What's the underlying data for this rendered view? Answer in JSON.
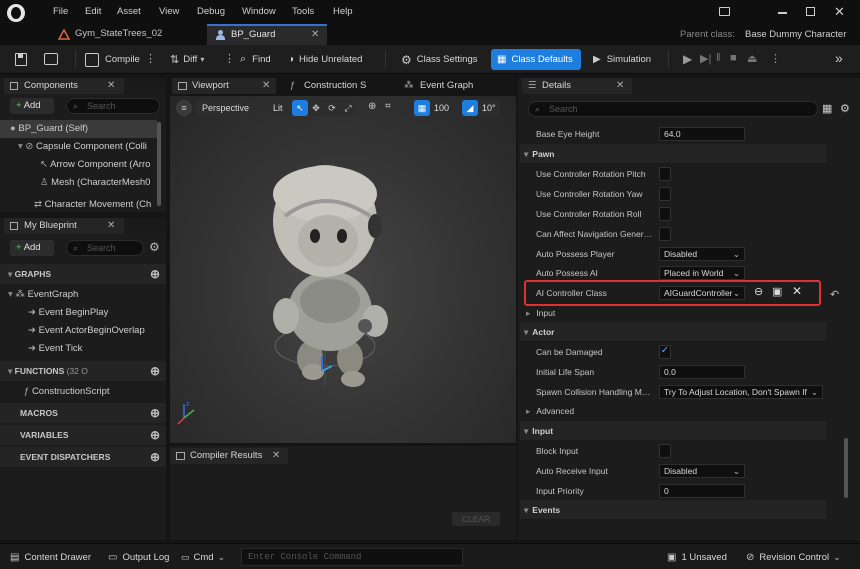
{
  "menu": [
    "File",
    "Edit",
    "Asset",
    "View",
    "Debug",
    "Window",
    "Tools",
    "Help"
  ],
  "tabs": {
    "tab1": "Gym_StateTrees_02",
    "tab2": "BP_Guard"
  },
  "parent_class": {
    "label": "Parent class:",
    "value": "Base Dummy Character"
  },
  "toolbar": {
    "compile": "Compile",
    "diff": "Diff",
    "find": "Find",
    "hide_unrelated": "Hide Unrelated",
    "class_settings": "Class Settings",
    "class_defaults": "Class Defaults",
    "simulation": "Simulation"
  },
  "components": {
    "title": "Components",
    "add": "Add",
    "search_placeholder": "Search",
    "items": [
      {
        "label": "BP_Guard (Self)"
      },
      {
        "label": "Capsule Component (Colli"
      },
      {
        "label": "Arrow Component (Arro"
      },
      {
        "label": "Mesh (CharacterMesh0"
      },
      {
        "label": "Character Movement (Ch"
      }
    ]
  },
  "blueprint": {
    "title": "My Blueprint",
    "add": "Add",
    "search_placeholder": "Search",
    "graphs_label": "GRAPHS",
    "event_graph": "EventGraph",
    "events": [
      "Event BeginPlay",
      "Event ActorBeginOverlap",
      "Event Tick"
    ],
    "functions_label": "FUNCTIONS",
    "functions_count": "(32 O",
    "construction_script": "ConstructionScript",
    "macros": "MACROS",
    "variables": "VARIABLES",
    "event_dispatchers": "EVENT DISPATCHERS"
  },
  "viewport": {
    "tabs": [
      "Viewport",
      "Construction S",
      "Event Graph"
    ],
    "perspective": "Perspective",
    "lit": "Lit",
    "grid_snap": "100",
    "rot_snap": "10°"
  },
  "compiler": {
    "title": "Compiler Results",
    "clear": "CLEAR"
  },
  "details": {
    "title": "Details",
    "search_placeholder": "Search",
    "base_eye_height": {
      "label": "Base Eye Height",
      "value": "64.0"
    },
    "pawn_label": "Pawn",
    "pawn_checks": [
      {
        "label": "Use Controller Rotation Pitch",
        "checked": false
      },
      {
        "label": "Use Controller Rotation Yaw",
        "checked": false
      },
      {
        "label": "Use Controller Rotation Roll",
        "checked": false
      },
      {
        "label": "Can Affect Navigation Gener…",
        "checked": false
      }
    ],
    "auto_possess_player": {
      "label": "Auto Possess Player",
      "value": "Disabled"
    },
    "auto_possess_ai": {
      "label": "Auto Possess AI",
      "value": "Placed in World"
    },
    "ai_controller": {
      "label": "AI Controller Class",
      "value": "AIGuardController"
    },
    "input_label": "Input",
    "actor_label": "Actor",
    "can_be_damaged": {
      "label": "Can be Damaged",
      "checked": true
    },
    "initial_life_span": {
      "label": "Initial Life Span",
      "value": "0.0"
    },
    "spawn_collision": {
      "label": "Spawn Collision Handling M…",
      "value": "Try To Adjust Location, Don't Spawn If"
    },
    "advanced_label": "Advanced",
    "input2_label": "Input",
    "block_input": {
      "label": "Block Input",
      "checked": false
    },
    "auto_receive_input": {
      "label": "Auto Receive Input",
      "value": "Disabled"
    },
    "input_priority": {
      "label": "Input Priority",
      "value": "0"
    },
    "events_label": "Events"
  },
  "status": {
    "content_drawer": "Content Drawer",
    "output_log": "Output Log",
    "cmd": "Cmd",
    "console_placeholder": "Enter Console Command",
    "unsaved": "1 Unsaved",
    "revision_control": "Revision Control"
  },
  "colors": {
    "accent": "#1e7ee0",
    "highlight": "#e03030",
    "selected_row": "#3a3a3a"
  }
}
